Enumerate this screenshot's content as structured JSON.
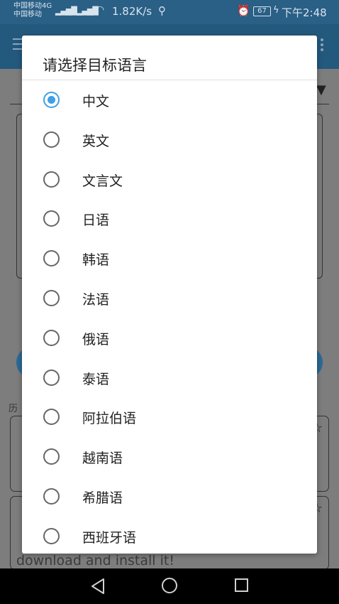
{
  "status_bar": {
    "carrier_line1": "中国移动4G",
    "carrier_line2": "中国移动",
    "net_speed": "1.82K/s",
    "battery": "67",
    "time": "下午2:48"
  },
  "dialog": {
    "title": "请选择目标语言",
    "selected": "中文",
    "options": [
      "中文",
      "英文",
      "文言文",
      "日语",
      "韩语",
      "法语",
      "俄语",
      "泰语",
      "阿拉伯语",
      "越南语",
      "希腊语",
      "西班牙语"
    ]
  },
  "background": {
    "visible_text": "download and install it!"
  },
  "colors": {
    "accent": "#3ea0e6",
    "app_bar": "#24597e",
    "status_bar": "#2a5f86"
  }
}
